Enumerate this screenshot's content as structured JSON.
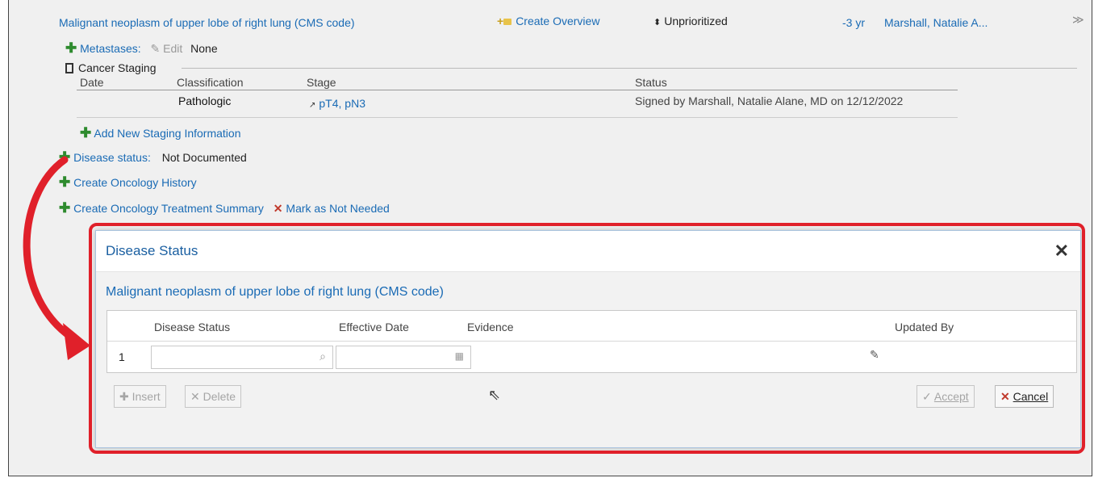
{
  "problem": {
    "title": "Malignant neoplasm of upper lobe of right lung (CMS code)",
    "create_overview": "Create Overview",
    "priority": "Unprioritized",
    "age": "-3 yr",
    "provider": "Marshall, Natalie A...",
    "metastases_label": "Metastases:",
    "edit_label": "Edit",
    "metastases_value": "None",
    "cancer_staging_label": "Cancer Staging",
    "staging_headers": [
      "Date",
      "Classification",
      "Stage",
      "Status"
    ],
    "staging_row": {
      "date": "",
      "classification": "Pathologic",
      "stage": "pT4, pN3",
      "status": "Signed by Marshall, Natalie Alane, MD on 12/12/2022"
    },
    "add_staging": "Add New Staging Information",
    "disease_status_label": "Disease status:",
    "disease_status_value": "Not Documented",
    "create_oncology_history": "Create Oncology History",
    "create_treatment_summary": "Create Oncology Treatment Summary",
    "mark_not_needed": "Mark as Not Needed"
  },
  "dialog": {
    "title": "Disease Status",
    "subtitle": "Malignant neoplasm of upper lobe of right lung (CMS code)",
    "columns": [
      "Disease Status",
      "Effective Date",
      "Evidence",
      "Updated By"
    ],
    "row_number": "1",
    "insert_label": "Insert",
    "delete_label": "Delete",
    "accept_label": "Accept",
    "cancel_label": "Cancel"
  },
  "annotation_colors": {
    "highlight": "#e0202a",
    "link": "#1a6bb5",
    "add_icon": "#2e8b2e"
  }
}
